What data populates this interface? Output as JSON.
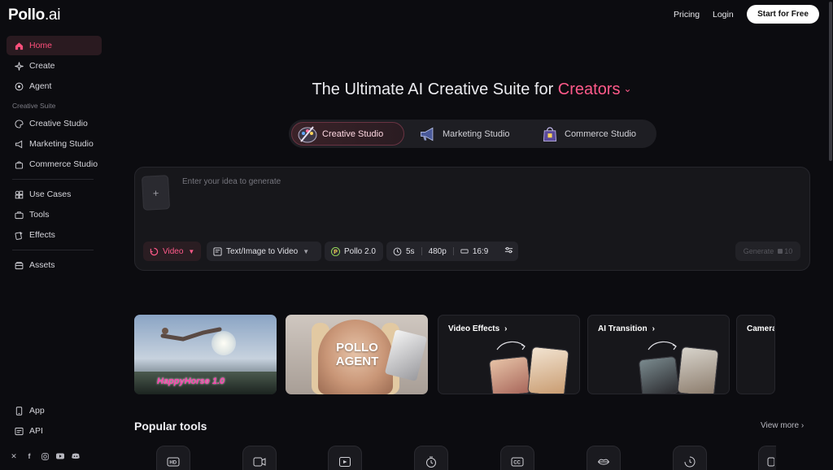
{
  "brand": {
    "logo_main": "Pollo",
    "logo_suffix": ".ai"
  },
  "sidebar": {
    "items": [
      {
        "label": "Home",
        "icon": "home-icon",
        "active": true
      },
      {
        "label": "Create",
        "icon": "sparkle-icon"
      },
      {
        "label": "Agent",
        "icon": "agent-icon"
      },
      {
        "label": "Creative Studio",
        "icon": "palette-icon"
      },
      {
        "label": "Marketing Studio",
        "icon": "megaphone-icon"
      },
      {
        "label": "Commerce Studio",
        "icon": "shopping-bag-icon"
      },
      {
        "label": "Use Cases",
        "icon": "grid-icon"
      },
      {
        "label": "Tools",
        "icon": "toolbox-icon"
      },
      {
        "label": "Effects",
        "icon": "effects-icon"
      },
      {
        "label": "Assets",
        "icon": "folder-icon"
      },
      {
        "label": "App",
        "icon": "phone-icon"
      },
      {
        "label": "API",
        "icon": "api-icon"
      }
    ],
    "section_label": "Creative Suite",
    "social": [
      "x-icon",
      "facebook-icon",
      "instagram-icon",
      "youtube-icon",
      "discord-icon"
    ]
  },
  "header": {
    "pricing": "Pricing",
    "login": "Login",
    "cta": "Start for Free"
  },
  "hero": {
    "title_prefix": "The Ultimate AI Creative Suite for ",
    "title_accent": "Creators",
    "chevron": "⌄"
  },
  "studio_tabs": [
    {
      "label": "Creative Studio",
      "active": true
    },
    {
      "label": "Marketing Studio"
    },
    {
      "label": "Commerce Studio"
    }
  ],
  "prompt": {
    "upload_glyph": "+",
    "placeholder": "Enter your idea to generate",
    "mode": "Video",
    "task": "Text/Image to Video",
    "model": "Pollo 2.0",
    "duration": "5s",
    "resolution": "480p",
    "ratio": "16:9",
    "generate_label": "Generate",
    "credits": "10"
  },
  "cards": [
    {
      "title": "HappyHorse 1.0"
    },
    {
      "title_line1": "POLLO",
      "title_line2": "AGENT"
    },
    {
      "title": "Video Effects",
      "arrow": "›"
    },
    {
      "title": "AI Transition",
      "arrow": "›"
    },
    {
      "title": "Camera"
    }
  ],
  "popular": {
    "title": "Popular tools",
    "view_more": "View more",
    "view_more_arrow": "›",
    "tools": [
      "hd-icon",
      "video-swap-icon",
      "image-to-video-icon",
      "timer-icon",
      "cc-icon",
      "lips-icon",
      "clock-icon",
      "more-icon"
    ],
    "hd_label": "HD",
    "cc_label": "CC"
  },
  "colors": {
    "accent": "#ff5a8a",
    "background": "#0c0c10",
    "panel": "#17171b"
  }
}
